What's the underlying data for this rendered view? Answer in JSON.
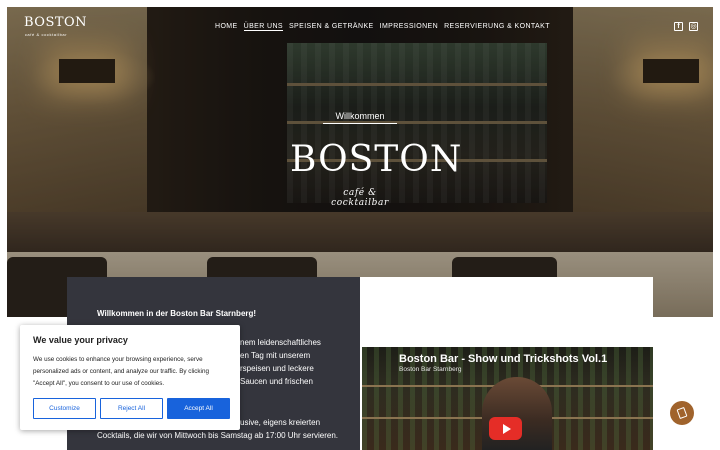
{
  "header": {
    "logo_text": "BOSTON",
    "logo_subtext": "café & cocktailbar",
    "nav": [
      {
        "label": "HOME",
        "active": false
      },
      {
        "label": "ÜBER UNS",
        "active": true
      },
      {
        "label": "SPEISEN & GETRÄNKE",
        "active": false
      },
      {
        "label": "IMPRESSIONEN",
        "active": false
      },
      {
        "label": "RESERVIERUNG & KONTAKT",
        "active": false
      }
    ],
    "social": [
      {
        "icon": "facebook-icon",
        "glyph": "f"
      },
      {
        "icon": "tripadvisor-icon",
        "glyph": "◎"
      }
    ]
  },
  "hero": {
    "welcome": "Willkommen",
    "brand": "BOSTON",
    "tagline": "café & cocktailbar"
  },
  "content": {
    "title": "Willkommen in der Boston Bar Starnberg!",
    "lines_partial": [
      "nem leidenschaftliches",
      "en Tag mit unserem",
      "rspeisen und leckere",
      "Saucen und frischen"
    ],
    "line_end_1": "usive, eigens kreierten",
    "line_end_2": "Cocktails, die wir von Mittwoch bis Samstag ab 17:00 Uhr servieren."
  },
  "video": {
    "title": "Boston Bar - Show und Trickshots Vol.1",
    "channel": "Boston Bar Starnberg",
    "play_icon": "play-icon"
  },
  "cookie_banner": {
    "title": "We value your privacy",
    "text": "We use cookies to enhance your browsing experience, serve personalized ads or content, and analyze our traffic. By clicking \"Accept All\", you consent to our use of cookies.",
    "buttons": {
      "customize": "Customize",
      "reject": "Reject All",
      "accept": "Accept All"
    }
  },
  "floating_button": {
    "icon": "book-icon"
  },
  "colors": {
    "accent_blue": "#1863dc",
    "card_dark": "#34353d",
    "fab_brown": "#a0632c",
    "play_red": "#e52d27"
  }
}
